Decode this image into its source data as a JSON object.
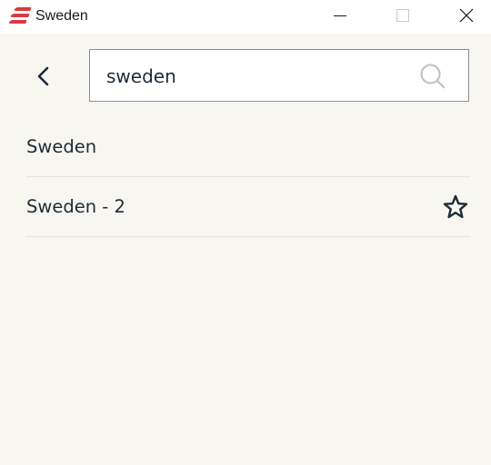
{
  "window": {
    "title": "Sweden",
    "icons": {
      "logo": "expressvpn-logo",
      "minimize": "minimize-icon",
      "maximize": "maximize-icon",
      "close": "close-icon"
    }
  },
  "search": {
    "value": "sweden",
    "placeholder": "",
    "icon": "search-icon"
  },
  "nav": {
    "back_icon": "chevron-left-icon"
  },
  "results": [
    {
      "label": "Sweden",
      "favorite_icon": ""
    },
    {
      "label": "Sweden - 2",
      "favorite_icon": "star-outline-icon"
    }
  ],
  "colors": {
    "background": "#f7f6f1",
    "titlebar": "#ffffff",
    "text": "#1f2b36",
    "logo_red": "#da3940",
    "divider": "#e4e3de",
    "search_border": "#8c8f93"
  }
}
